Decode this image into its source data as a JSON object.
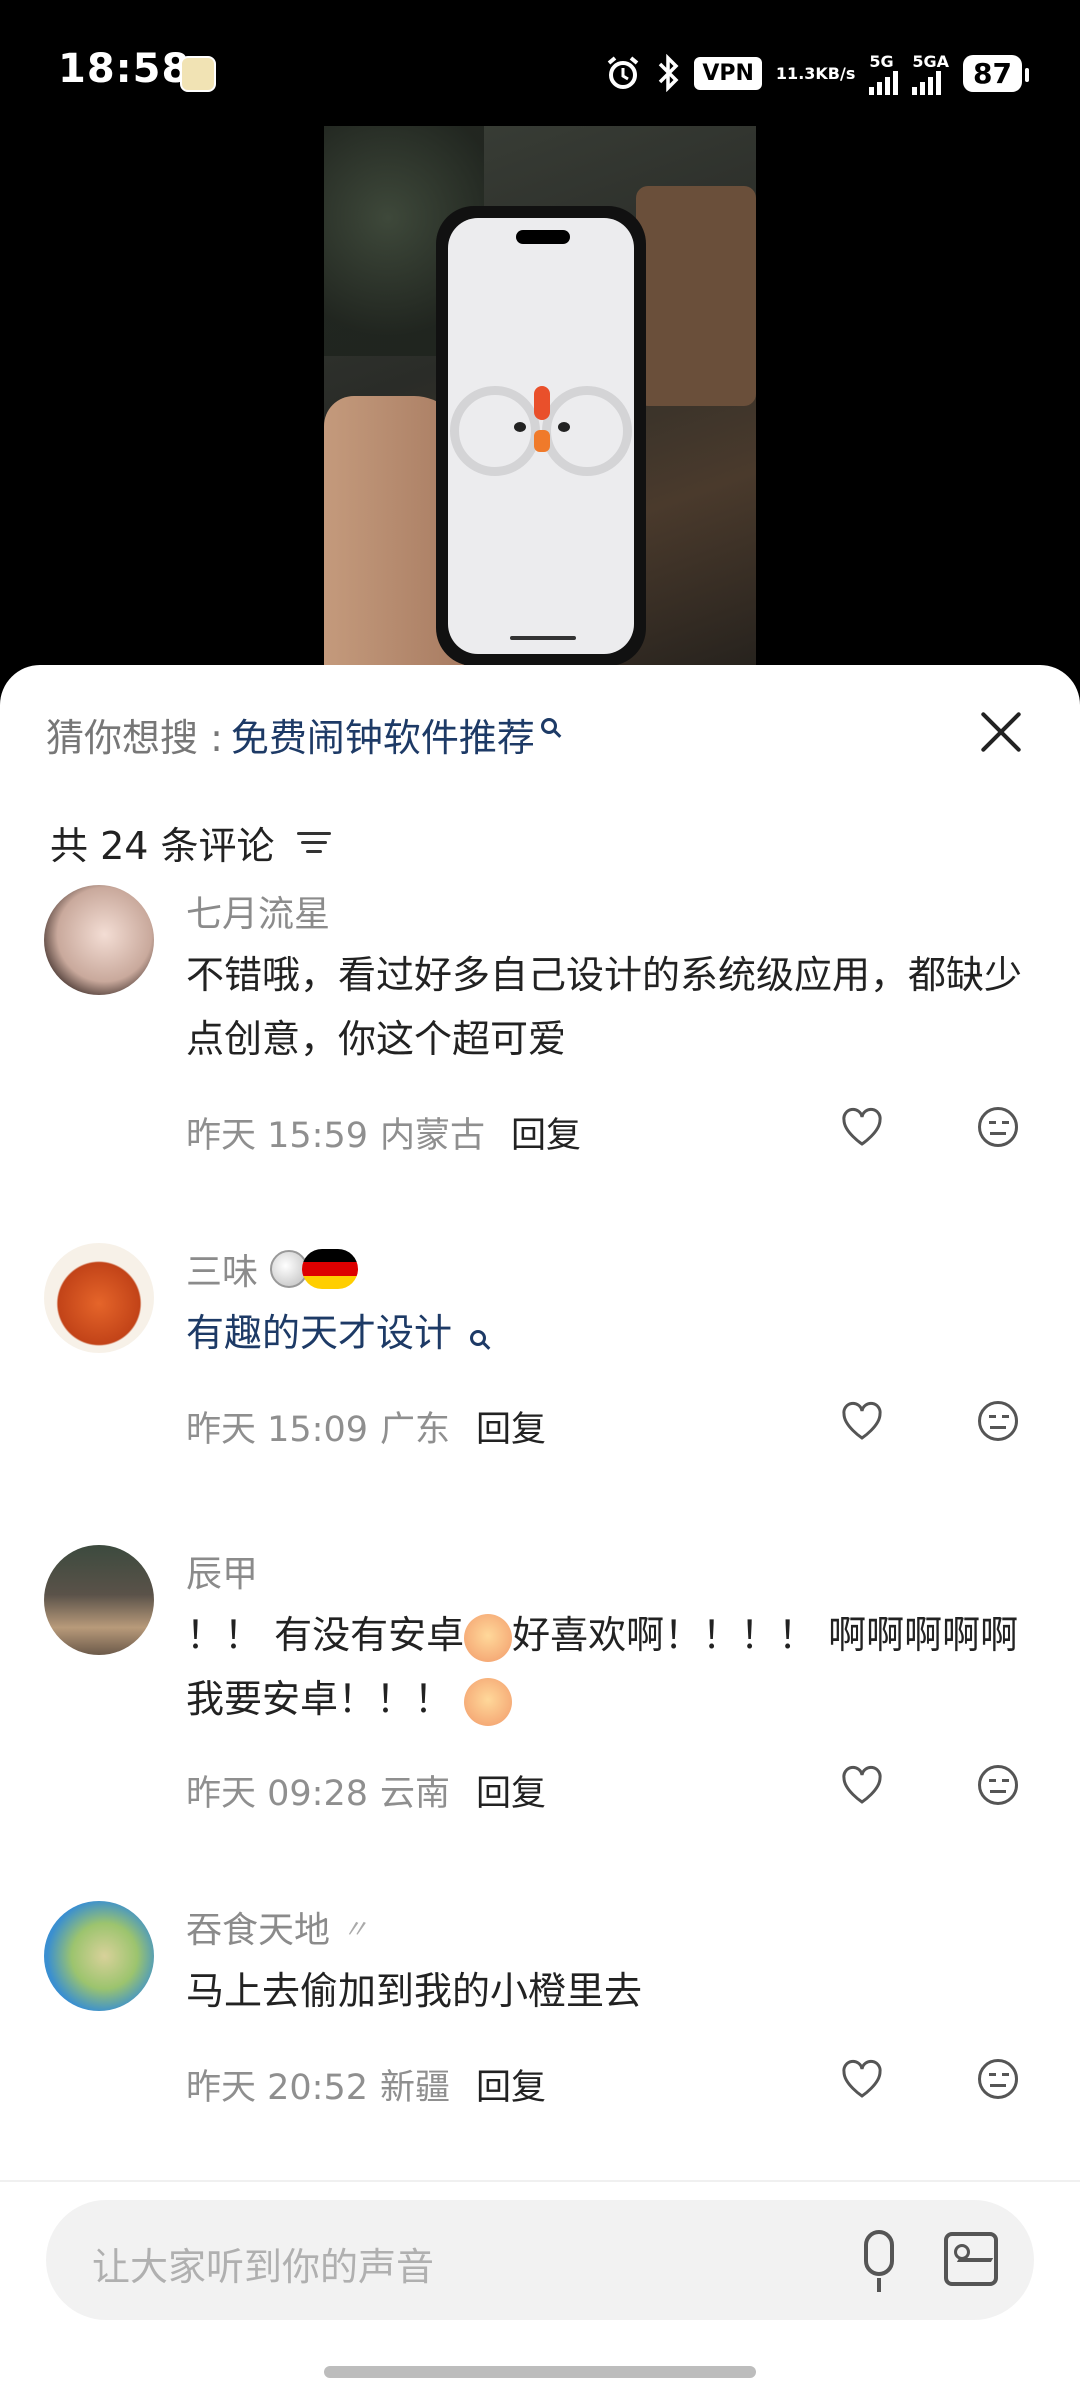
{
  "status_bar": {
    "time": "18:58",
    "vpn": "VPN",
    "speed_value": "11.3",
    "speed_unit": "KB/s",
    "net1": "5G",
    "net2": "5GA",
    "battery": "87",
    "icons": [
      "app-badge-icon",
      "alarm-icon",
      "bluetooth-icon",
      "signal-icon"
    ]
  },
  "video": {
    "description_icon": "phone-rooster-alarm"
  },
  "sheet": {
    "suggest_prefix": "猜你想搜 :",
    "suggest_query": "免费闹钟软件推荐",
    "comment_count": "共 24 条评论"
  },
  "comments": [
    {
      "name": "七月流星",
      "text": "不错哦，看过好多自己设计的系统级应用，都缺少点创意，你这个超可爱",
      "date": "昨天 15:59",
      "location": "内蒙古",
      "reply": "回复"
    },
    {
      "name": "三味",
      "text": "有趣的天才设计",
      "date": "昨天 15:09",
      "location": "广东",
      "reply": "回复"
    },
    {
      "name": "辰甲",
      "text_a": "！！ 有没有安卓",
      "text_b": "好喜欢啊！！！！ 啊啊啊啊啊我要安卓！！！",
      "date": "昨天 09:28",
      "location": "云南",
      "reply": "回复"
    },
    {
      "name": "吞食天地",
      "text": "马上去偷加到我的小橙里去",
      "date": "昨天 20:52",
      "location": "新疆",
      "reply": "回复"
    }
  ],
  "input": {
    "placeholder": "让大家听到你的声音"
  },
  "colors": {
    "link": "#1d3a66",
    "muted": "#8b8b8b",
    "text": "#222222"
  }
}
